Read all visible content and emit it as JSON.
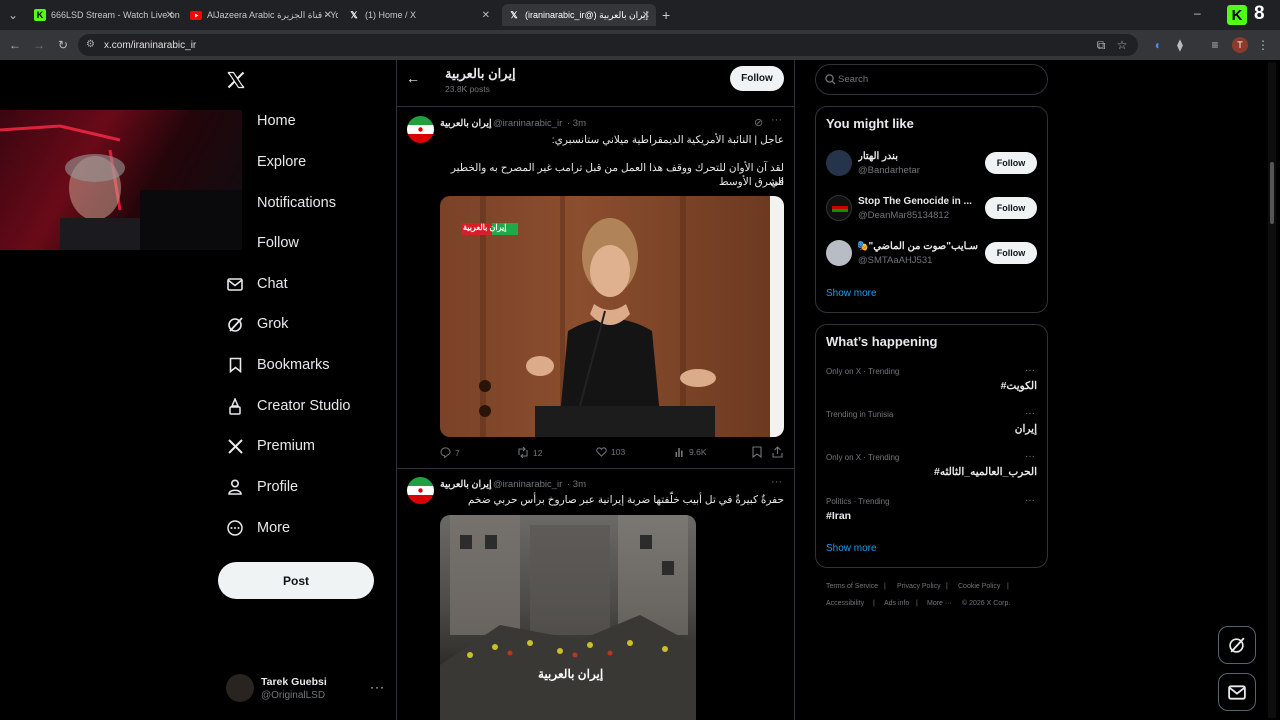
{
  "browser": {
    "tabs": [
      {
        "title": "666LSD Stream - Watch Live on",
        "icon": "kick-icon",
        "active": false
      },
      {
        "title": "AlJazeera Arabic قناة الجزيرة - Yo",
        "icon": "youtube-icon",
        "active": false
      },
      {
        "title": "(1) Home / X",
        "icon": "x-icon",
        "active": false
      },
      {
        "title": "إيران بالعربية (@iraninarabic_ir)",
        "icon": "x-icon",
        "active": true
      }
    ],
    "new_tab": "+",
    "url": "x.com/iraninarabic_ir",
    "kick_badge": "8",
    "profile_initial": "T"
  },
  "nav": {
    "items": [
      {
        "label": "Home",
        "icon": "home-icon"
      },
      {
        "label": "Explore",
        "icon": "search-icon"
      },
      {
        "label": "Notifications",
        "icon": "bell-icon"
      },
      {
        "label": "Follow",
        "icon": "person-plus-icon"
      },
      {
        "label": "Chat",
        "icon": "mail-icon"
      },
      {
        "label": "Grok",
        "icon": "grok-icon"
      },
      {
        "label": "Bookmarks",
        "icon": "bookmark-icon"
      },
      {
        "label": "Creator Studio",
        "icon": "creator-icon"
      },
      {
        "label": "Premium",
        "icon": "x-icon"
      },
      {
        "label": "Profile",
        "icon": "person-icon"
      },
      {
        "label": "More",
        "icon": "more-circle-icon"
      }
    ],
    "post_label": "Post",
    "account": {
      "name": "Tarek Guebsi",
      "handle": "@OriginalLSD"
    }
  },
  "profile_header": {
    "name": "إيران بالعربية",
    "posts": "23.8K posts",
    "follow_label": "Follow"
  },
  "tweets": [
    {
      "author": "إيران بالعربية",
      "handle": "@iraninarabic_ir",
      "time": "· 3m",
      "line1": "عاجل | النائبة الأمريكية الديمقراطية ميلاني ستانسبري:",
      "line2": "لقد آن الأوان للتحرك ووقف هذا العمل من قبل ترامب غير المصرح به والخطير في",
      "line3": "الشرق الأوسط",
      "image_badge": "إيران بالعربية",
      "replies": "7",
      "reposts": "12",
      "likes": "103",
      "views": "9.6K"
    },
    {
      "author": "إيران بالعربية",
      "handle": "@iraninarabic_ir",
      "time": "· 3m",
      "line1": "حفرةٌ كبيرةٌ في تل أبيب خلّفتها ضربة إيرانية عبر صاروخ برأس حربي ضخم",
      "image_caption": "إيران بالعربية"
    }
  ],
  "search": {
    "placeholder": "Search"
  },
  "you_might_like": {
    "title": "You might like",
    "users": [
      {
        "name": "بندر الهتار",
        "handle": "@Bandarhetar",
        "follow": "Follow"
      },
      {
        "name": "Stop The Genocide in ...",
        "handle": "@DeanMar85134812",
        "follow": "Follow"
      },
      {
        "name": "سـايب\"صوت من الماضي\"🎭",
        "handle": "@SMTAaAHJ531",
        "follow": "Follow"
      }
    ],
    "show_more": "Show more"
  },
  "whats_happening": {
    "title": "What’s happening",
    "trends": [
      {
        "meta": "Only on X · Trending",
        "name": "#الكويت"
      },
      {
        "meta": "Trending in Tunisia",
        "name": "إيران"
      },
      {
        "meta": "Only on X · Trending",
        "name": "#الحرب_العالميه_الثالثه"
      },
      {
        "meta": "Politics · Trending",
        "name": "#Iran"
      }
    ],
    "show_more": "Show more"
  },
  "footer": {
    "links": [
      "Terms of Service",
      "Privacy Policy",
      "Cookie Policy",
      "Accessibility",
      "Ads info",
      "More ···"
    ],
    "copyright": "© 2026 X Corp."
  },
  "colors": {
    "accent": "#1d9bf0",
    "bg": "#000000",
    "border": "#2f3336",
    "muted": "#71767b"
  }
}
